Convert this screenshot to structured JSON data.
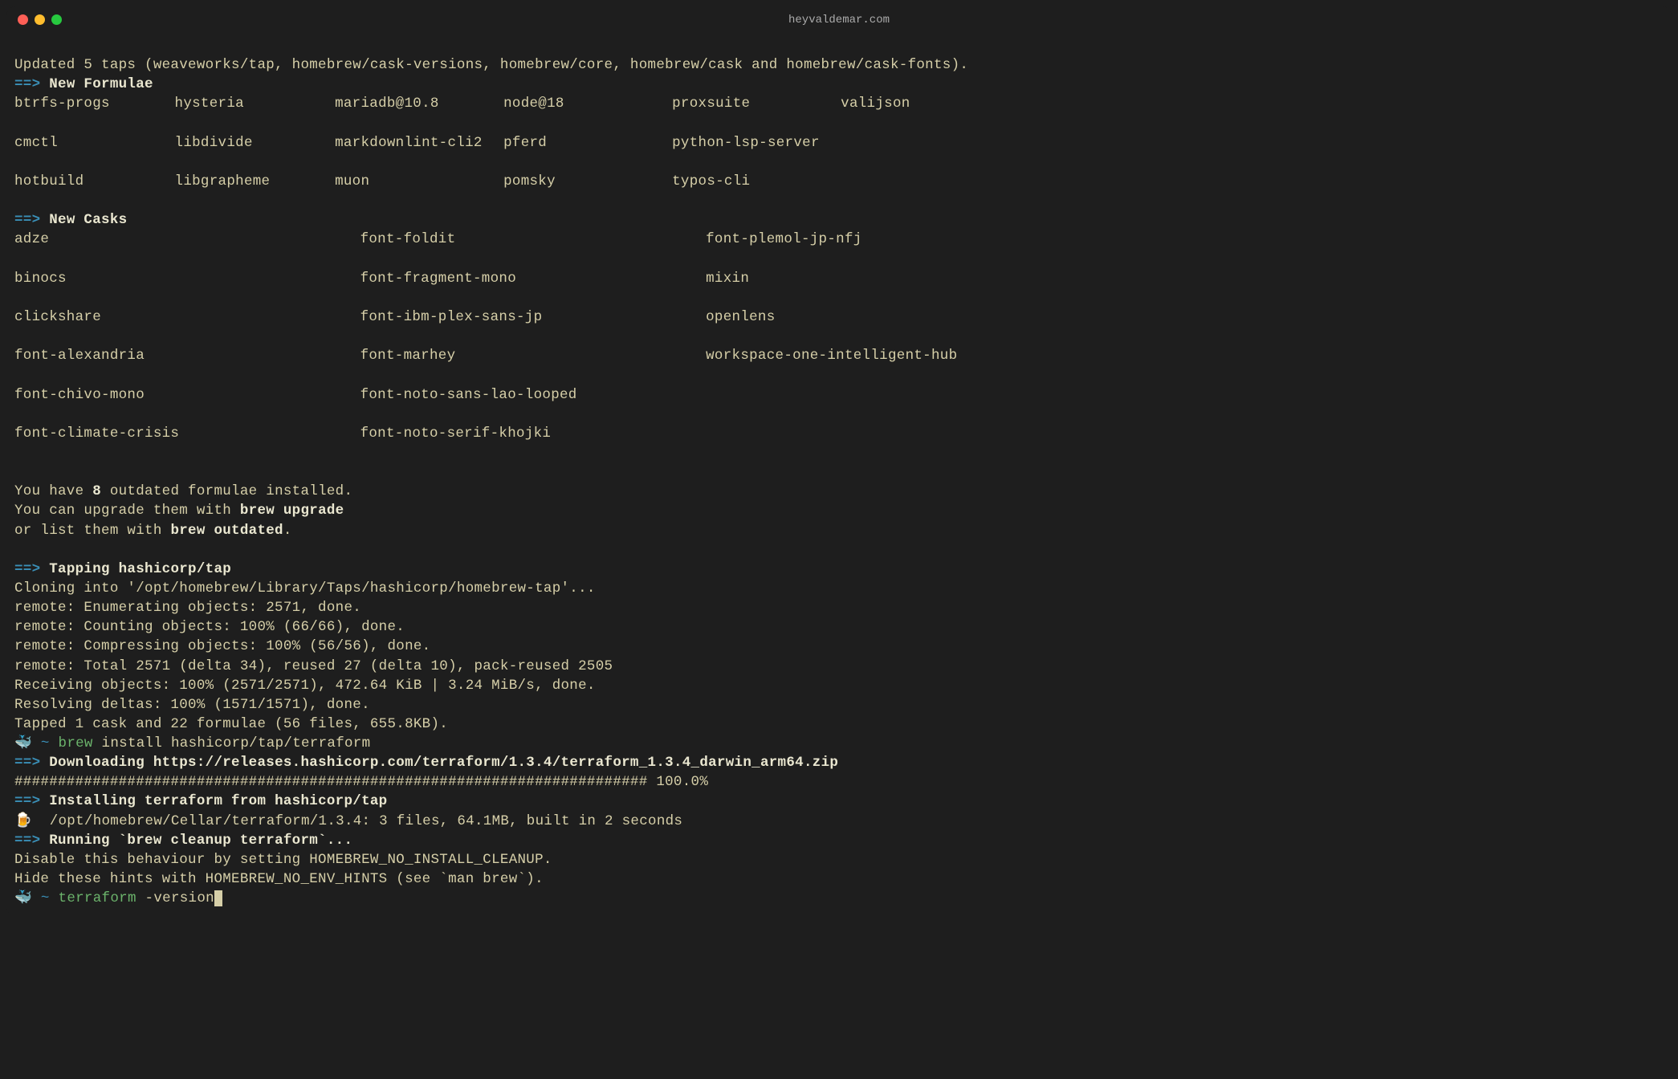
{
  "title": "heyvaldemar.com",
  "updated_line": "Updated 5 taps (weaveworks/tap, homebrew/cask-versions, homebrew/core, homebrew/cask and homebrew/cask-fonts).",
  "arrow": "==>",
  "sections": {
    "new_formulae": "New Formulae",
    "new_casks": "New Casks",
    "tapping": "Tapping hashicorp/tap",
    "downloading": "Downloading https://releases.hashicorp.com/terraform/1.3.4/terraform_1.3.4_darwin_arm64.zip",
    "installing": "Installing terraform from hashicorp/tap",
    "running": "Running `brew cleanup terraform`..."
  },
  "formulae": {
    "r1": [
      "btrfs-progs",
      "hysteria",
      "mariadb@10.8",
      "node@18",
      "proxsuite",
      "valijson"
    ],
    "r2": [
      "cmctl",
      "libdivide",
      "markdownlint-cli2",
      "pferd",
      "python-lsp-server",
      ""
    ],
    "r3": [
      "hotbuild",
      "libgrapheme",
      "muon",
      "pomsky",
      "typos-cli",
      ""
    ]
  },
  "casks": {
    "r1": [
      "adze",
      "font-foldit",
      "font-plemol-jp-nfj"
    ],
    "r2": [
      "binocs",
      "font-fragment-mono",
      "mixin"
    ],
    "r3": [
      "clickshare",
      "font-ibm-plex-sans-jp",
      "openlens"
    ],
    "r4": [
      "font-alexandria",
      "font-marhey",
      "workspace-one-intelligent-hub"
    ],
    "r5": [
      "font-chivo-mono",
      "font-noto-sans-lao-looped",
      ""
    ],
    "r6": [
      "font-climate-crisis",
      "font-noto-serif-khojki",
      ""
    ]
  },
  "outdated": {
    "l1a": "You have ",
    "l1b": "8",
    "l1c": " outdated formulae installed.",
    "l2a": "You can upgrade them with ",
    "l2b": "brew upgrade",
    "l3a": "or list them with ",
    "l3b": "brew outdated",
    "l3c": "."
  },
  "clone": {
    "l1": "Cloning into '/opt/homebrew/Library/Taps/hashicorp/homebrew-tap'...",
    "l2": "remote: Enumerating objects: 2571, done.",
    "l3": "remote: Counting objects: 100% (66/66), done.",
    "l4": "remote: Compressing objects: 100% (56/56), done.",
    "l5": "remote: Total 2571 (delta 34), reused 27 (delta 10), pack-reused 2505",
    "l6": "Receiving objects: 100% (2571/2571), 472.64 KiB | 3.24 MiB/s, done.",
    "l7": "Resolving deltas: 100% (1571/1571), done.",
    "l8": "Tapped 1 cask and 22 formulae (56 files, 655.8KB)."
  },
  "prompt1": {
    "whale": "🐳",
    "tilde": "~",
    "cmd": "brew",
    "args": " install hashicorp/tap/terraform"
  },
  "progress": "######################################################################### 100.0%",
  "install_line": {
    "beer": "🍺",
    "text": "  /opt/homebrew/Cellar/terraform/1.3.4: 3 files, 64.1MB, built in 2 seconds"
  },
  "cleanup": {
    "l1": "Disable this behaviour by setting HOMEBREW_NO_INSTALL_CLEANUP.",
    "l2": "Hide these hints with HOMEBREW_NO_ENV_HINTS (see `man brew`)."
  },
  "prompt2": {
    "whale": "🐳",
    "tilde": "~",
    "cmd": "terraform",
    "args": " -version"
  }
}
